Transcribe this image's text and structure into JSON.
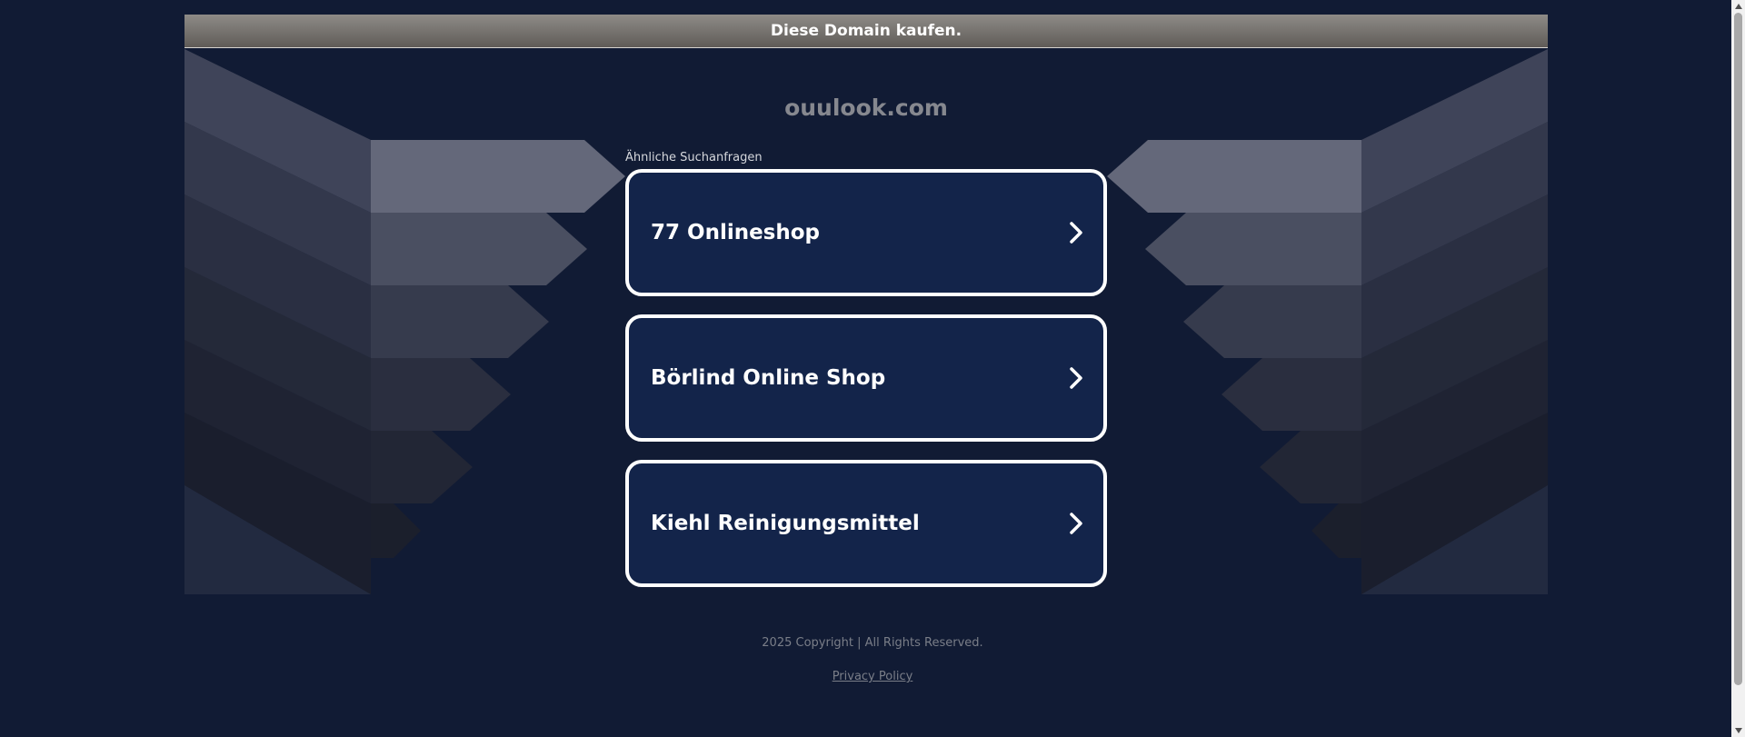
{
  "header": {
    "buy_domain": "Diese Domain kaufen."
  },
  "domain": {
    "name": "ouulook.com"
  },
  "related": {
    "label": "Ähnliche Suchanfragen",
    "links": [
      {
        "label": "77 Onlineshop"
      },
      {
        "label": "Börlind Online Shop"
      },
      {
        "label": "Kiehl Reinigungsmittel"
      }
    ]
  },
  "footer": {
    "copyright": "2025 Copyright | All Rights Reserved.",
    "privacy": "Privacy Policy"
  },
  "colors": {
    "background": "#111b34",
    "link_box": "#13244a",
    "link_border": "#ffffff",
    "buy_bar_top": "#8e8b87",
    "buy_bar_bottom": "#605c58"
  },
  "icons": {
    "link_arrow": "chevron-right-icon",
    "scroll_up": "triangle-up-icon",
    "scroll_down": "triangle-down-icon"
  }
}
